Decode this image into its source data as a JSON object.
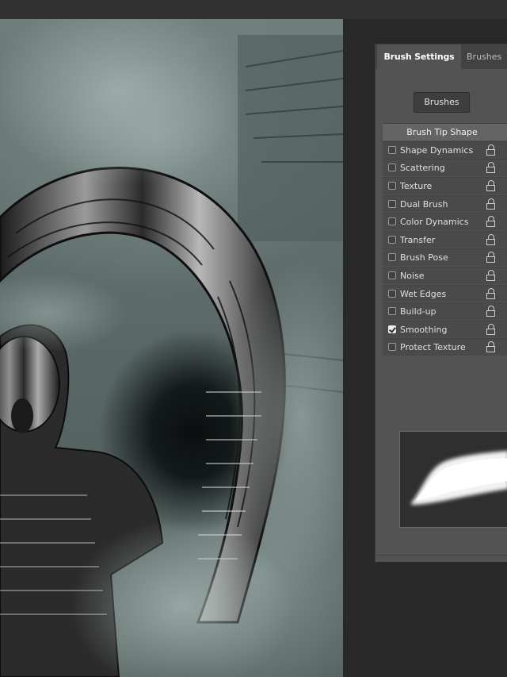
{
  "panel": {
    "tabs": [
      {
        "label": "Brush Settings",
        "active": true
      },
      {
        "label": "Brushes",
        "active": false
      }
    ],
    "brushes_button": "Brushes",
    "header": "Brush Tip Shape",
    "options": [
      {
        "label": "Shape Dynamics",
        "checked": false
      },
      {
        "label": "Scattering",
        "checked": false
      },
      {
        "label": "Texture",
        "checked": false
      },
      {
        "label": "Dual Brush",
        "checked": false
      },
      {
        "label": "Color Dynamics",
        "checked": false
      },
      {
        "label": "Transfer",
        "checked": false
      },
      {
        "label": "Brush Pose",
        "checked": false
      },
      {
        "label": "Noise",
        "checked": false
      },
      {
        "label": "Wet Edges",
        "checked": false
      },
      {
        "label": "Build-up",
        "checked": false
      },
      {
        "label": "Smoothing",
        "checked": true
      },
      {
        "label": "Protect Texture",
        "checked": false
      }
    ]
  },
  "icons": {
    "lock": "lock-icon",
    "checkbox_checked": "checkmark-icon"
  },
  "colors": {
    "panel_bg": "#535353",
    "tab_bar": "#424242",
    "header_row": "#646464",
    "canvas_fog": "#7f908d"
  }
}
